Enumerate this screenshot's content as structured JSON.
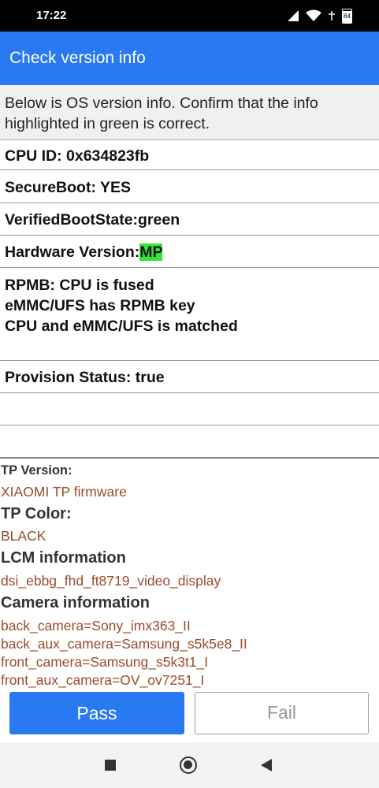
{
  "status_bar": {
    "time": "17:22",
    "battery": "84"
  },
  "app_bar": {
    "title": "Check version info"
  },
  "intro": {
    "line1": "Below is OS version info. Confirm that the info",
    "line2": "highlighted in green is correct."
  },
  "info": {
    "cpu_id": "CPU ID: 0x634823fb",
    "secure_boot": "SecureBoot: YES",
    "verified_boot_state": "VerifiedBootState:green",
    "hardware_version_label": "Hardware Version:",
    "hardware_version_value": "MP",
    "rpmb_line1": "RPMB: CPU is fused",
    "rpmb_line2": "eMMC/UFS has RPMB key",
    "rpmb_line3": "CPU and eMMC/UFS is matched",
    "provision_status": "Provision Status: true"
  },
  "details": {
    "tp_version_label": "TP Version:",
    "tp_version_value": "XIAOMI TP firmware",
    "tp_color_label": "TP Color:",
    "tp_color_value": "BLACK",
    "lcm_label": "LCM information",
    "lcm_value": "dsi_ebbg_fhd_ft8719_video_display",
    "camera_label": "Camera information",
    "cameras": [
      "back_camera=Sony_imx363_II",
      "back_aux_camera=Samsung_s5k5e8_II",
      "front_camera=Samsung_s5k3t1_I",
      "front_aux_camera=OV_ov7251_I"
    ]
  },
  "buttons": {
    "pass": "Pass",
    "fail": "Fail"
  },
  "colors": {
    "app_bar": "#2979f2",
    "highlight": "#33e633",
    "detail_value": "#9c4a2a"
  }
}
